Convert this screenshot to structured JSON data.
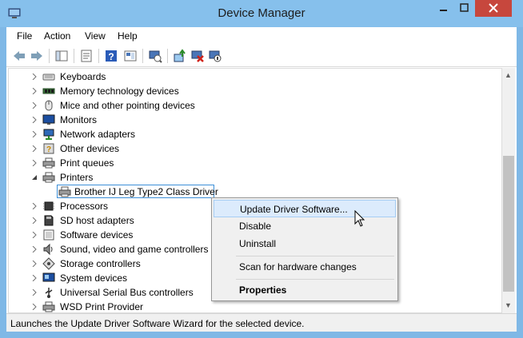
{
  "window": {
    "title": "Device Manager"
  },
  "menu": [
    "File",
    "Action",
    "View",
    "Help"
  ],
  "toolbar": {
    "icons": [
      "back-arrow-icon",
      "forward-arrow-icon",
      "show-hide-console-tree-icon",
      "properties-icon",
      "help-icon",
      "show-view-icon",
      "scan-hardware-icon",
      "update-driver-icon",
      "uninstall-icon",
      "disable-icon"
    ]
  },
  "tree": {
    "items": [
      {
        "label": "Keyboards",
        "icon": "keyboard-icon",
        "expanded": false
      },
      {
        "label": "Memory technology devices",
        "icon": "memory-icon",
        "expanded": false
      },
      {
        "label": "Mice and other pointing devices",
        "icon": "mouse-icon",
        "expanded": false
      },
      {
        "label": "Monitors",
        "icon": "monitor-icon",
        "expanded": false
      },
      {
        "label": "Network adapters",
        "icon": "network-icon",
        "expanded": false
      },
      {
        "label": "Other devices",
        "icon": "other-devices-icon",
        "expanded": false
      },
      {
        "label": "Print queues",
        "icon": "printer-icon",
        "expanded": false
      },
      {
        "label": "Printers",
        "icon": "printer-icon",
        "expanded": true
      },
      {
        "label": "Brother IJ Leg Type2 Class Driver",
        "icon": "printer-icon",
        "child": true,
        "selected": true
      },
      {
        "label": "Processors",
        "icon": "processor-icon",
        "expanded": false
      },
      {
        "label": "SD host adapters",
        "icon": "sd-card-icon",
        "expanded": false
      },
      {
        "label": "Software devices",
        "icon": "software-device-icon",
        "expanded": false
      },
      {
        "label": "Sound, video and game controllers",
        "icon": "speaker-icon",
        "expanded": false
      },
      {
        "label": "Storage controllers",
        "icon": "storage-icon",
        "expanded": false
      },
      {
        "label": "System devices",
        "icon": "system-devices-icon",
        "expanded": false
      },
      {
        "label": "Universal Serial Bus controllers",
        "icon": "usb-icon",
        "expanded": false
      },
      {
        "label": "WSD Print Provider",
        "icon": "printer-icon",
        "expanded": false
      }
    ]
  },
  "context_menu": {
    "update": "Update Driver Software...",
    "disable": "Disable",
    "uninstall": "Uninstall",
    "scan": "Scan for hardware changes",
    "properties": "Properties"
  },
  "status": {
    "text": "Launches the Update Driver Software Wizard for the selected device."
  },
  "colors": {
    "title_bar": "#86c0ec",
    "close_button": "#c7473d",
    "selection_border": "#3c8fd8",
    "menu_hover": "#dcebfc"
  }
}
